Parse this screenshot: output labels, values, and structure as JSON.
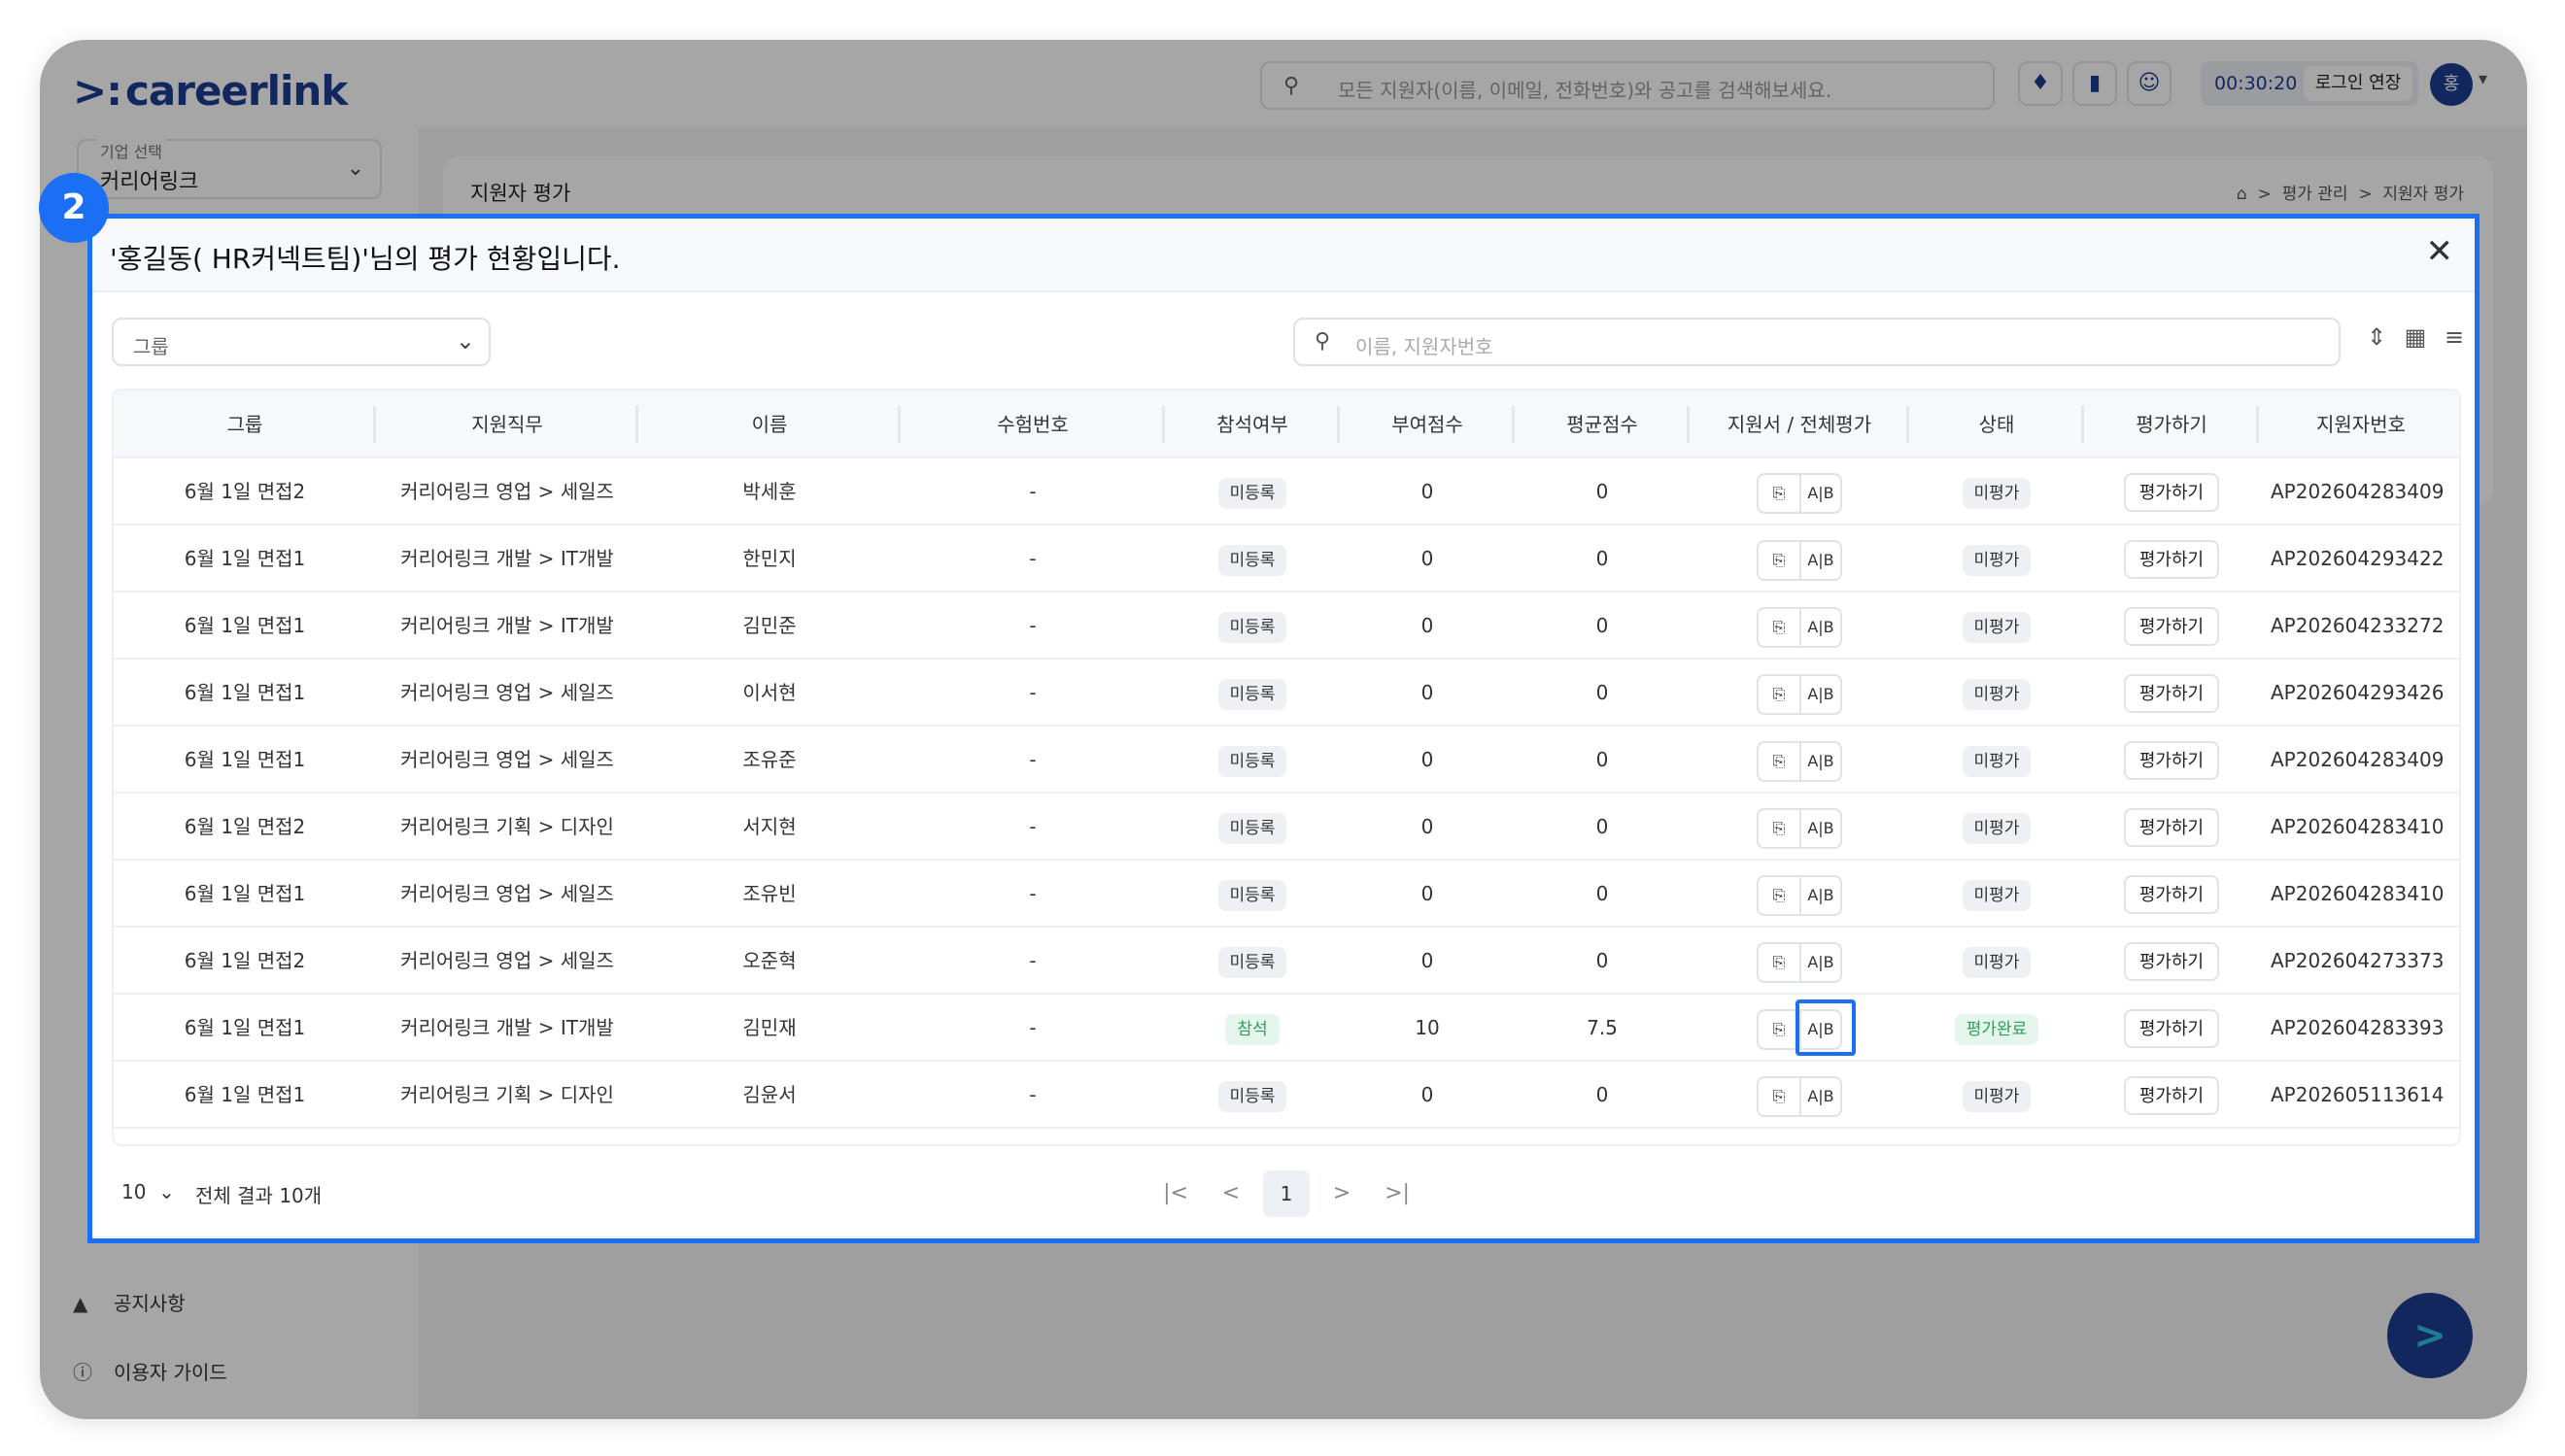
{
  "app": {
    "logo": "careerlink",
    "global_search_placeholder": "모든 지원자(이름, 이메일, 전화번호)와 공고를 검색해보세요.",
    "timer": "00:30:20",
    "extend_login": "로그인 연장",
    "avatar_initial": "홍",
    "company_label": "기업 선택",
    "company_value": "커리어링크",
    "page_title": "지원자 평가",
    "breadcrumb": [
      "평가 관리",
      "지원자 평가"
    ],
    "side_links": [
      "공지사항",
      "이용자 가이드"
    ]
  },
  "step_badge": "2",
  "modal": {
    "title": "'홍길동( HR커넥트팀)'님의 평가 현황입니다.",
    "group_placeholder": "그룹",
    "search_placeholder": "이름, 지원자번호",
    "columns": [
      "그룹",
      "지원직무",
      "이름",
      "수험번호",
      "참석여부",
      "부여점수",
      "평균점수",
      "지원서 / 전체평가",
      "상태",
      "평가하기",
      "지원자번호"
    ],
    "eval_button_label": "평가하기",
    "rows": [
      {
        "group": "6월 1일 면접2",
        "job": "커리어링크 영업 > 세일즈",
        "name": "박세훈",
        "exam": "-",
        "attend": "미등록",
        "score": "0",
        "avg": "0",
        "status": "미평가",
        "id": "AP202604283409"
      },
      {
        "group": "6월 1일 면접1",
        "job": "커리어링크 개발 > IT개발",
        "name": "한민지",
        "exam": "-",
        "attend": "미등록",
        "score": "0",
        "avg": "0",
        "status": "미평가",
        "id": "AP202604293422"
      },
      {
        "group": "6월 1일 면접1",
        "job": "커리어링크 개발 > IT개발",
        "name": "김민준",
        "exam": "-",
        "attend": "미등록",
        "score": "0",
        "avg": "0",
        "status": "미평가",
        "id": "AP202604233272"
      },
      {
        "group": "6월 1일 면접1",
        "job": "커리어링크 영업 > 세일즈",
        "name": "이서현",
        "exam": "-",
        "attend": "미등록",
        "score": "0",
        "avg": "0",
        "status": "미평가",
        "id": "AP202604293426"
      },
      {
        "group": "6월 1일 면접1",
        "job": "커리어링크 영업 > 세일즈",
        "name": "조유준",
        "exam": "-",
        "attend": "미등록",
        "score": "0",
        "avg": "0",
        "status": "미평가",
        "id": "AP202604283409"
      },
      {
        "group": "6월 1일 면접2",
        "job": "커리어링크 기획 > 디자인",
        "name": "서지현",
        "exam": "-",
        "attend": "미등록",
        "score": "0",
        "avg": "0",
        "status": "미평가",
        "id": "AP202604283410"
      },
      {
        "group": "6월 1일 면접1",
        "job": "커리어링크 영업 > 세일즈",
        "name": "조유빈",
        "exam": "-",
        "attend": "미등록",
        "score": "0",
        "avg": "0",
        "status": "미평가",
        "id": "AP202604283410"
      },
      {
        "group": "6월 1일 면접2",
        "job": "커리어링크 영업 > 세일즈",
        "name": "오준혁",
        "exam": "-",
        "attend": "미등록",
        "score": "0",
        "avg": "0",
        "status": "미평가",
        "id": "AP202604273373"
      },
      {
        "group": "6월 1일 면접1",
        "job": "커리어링크 개발 > IT개발",
        "name": "김민재",
        "exam": "-",
        "attend": "참석",
        "score": "10",
        "avg": "7.5",
        "status": "평가완료",
        "id": "AP202604283393"
      },
      {
        "group": "6월 1일 면접1",
        "job": "커리어링크 기획 > 디자인",
        "name": "김윤서",
        "exam": "-",
        "attend": "미등록",
        "score": "0",
        "avg": "0",
        "status": "미평가",
        "id": "AP202605113614"
      }
    ],
    "per_page": "10",
    "total": "전체 결과 10개",
    "current_page": "1"
  },
  "colors": {
    "accent": "#1a6ff5",
    "brand": "#1c3d8f",
    "done_green": "#2f9e5a"
  }
}
